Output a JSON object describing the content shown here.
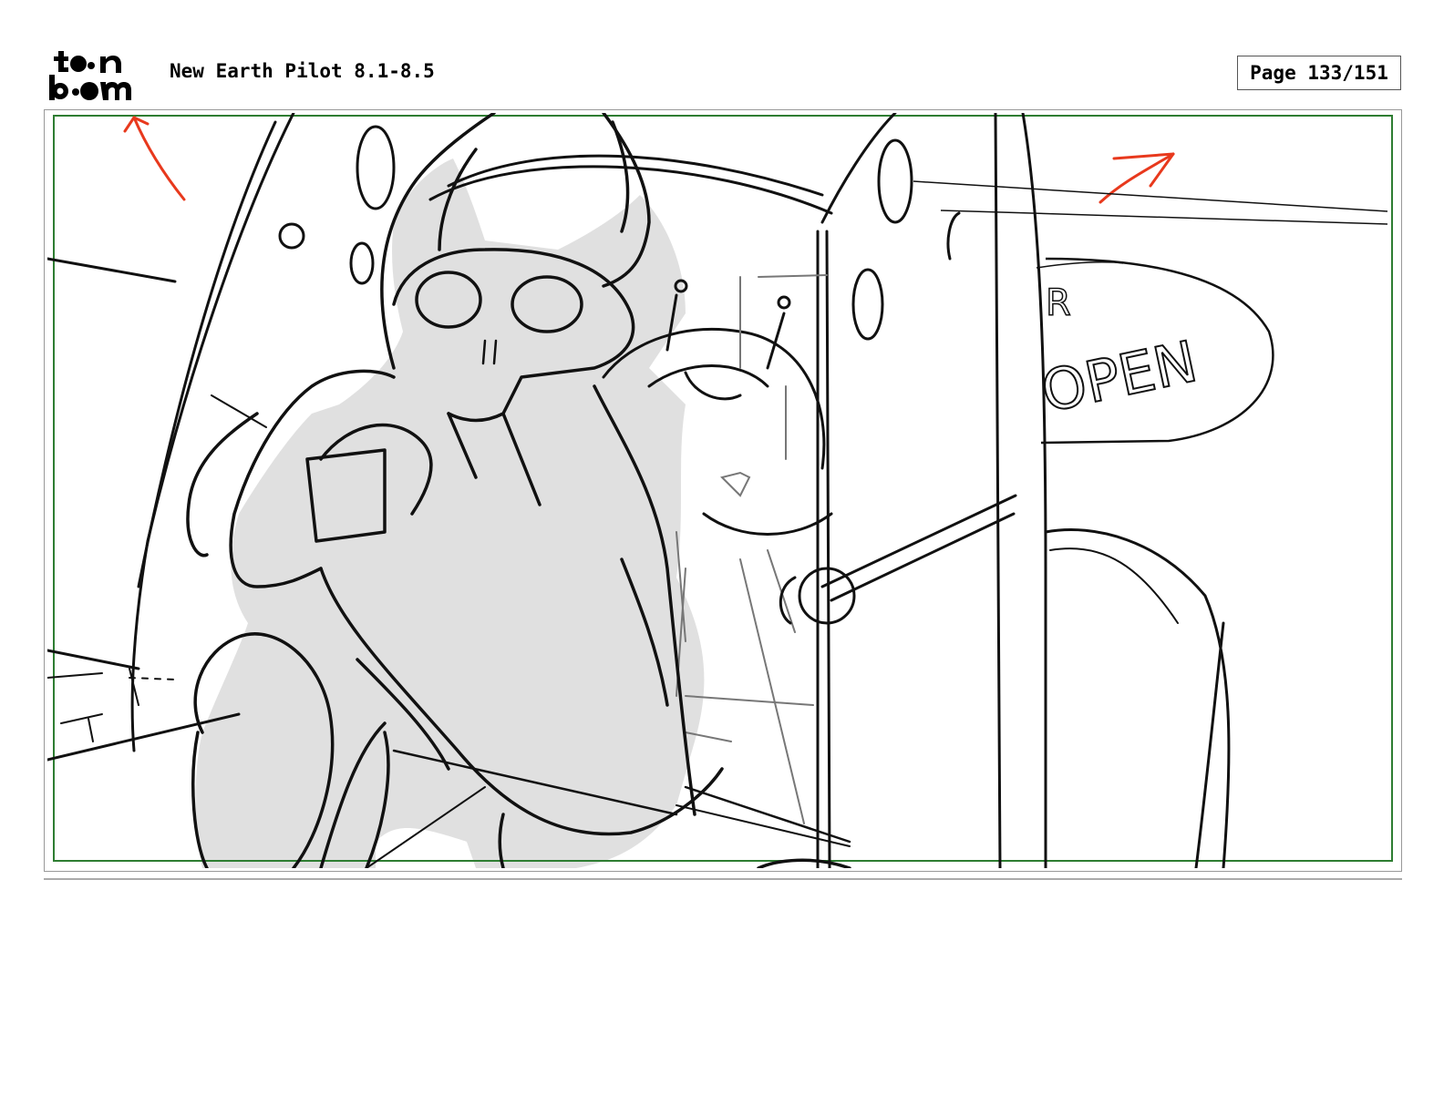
{
  "header": {
    "logo_line1": "toon",
    "logo_line2": "boom",
    "project_title": "New Earth Pilot 8.1-8.5",
    "page_label": "Page 133/151"
  },
  "panel": {
    "sign_text": "OPEN",
    "sign_text_partial": "R",
    "camera_move_color": "#e8391d",
    "safe_frame_color": "#2e7d32",
    "shading_color": "#e0e0e0"
  }
}
